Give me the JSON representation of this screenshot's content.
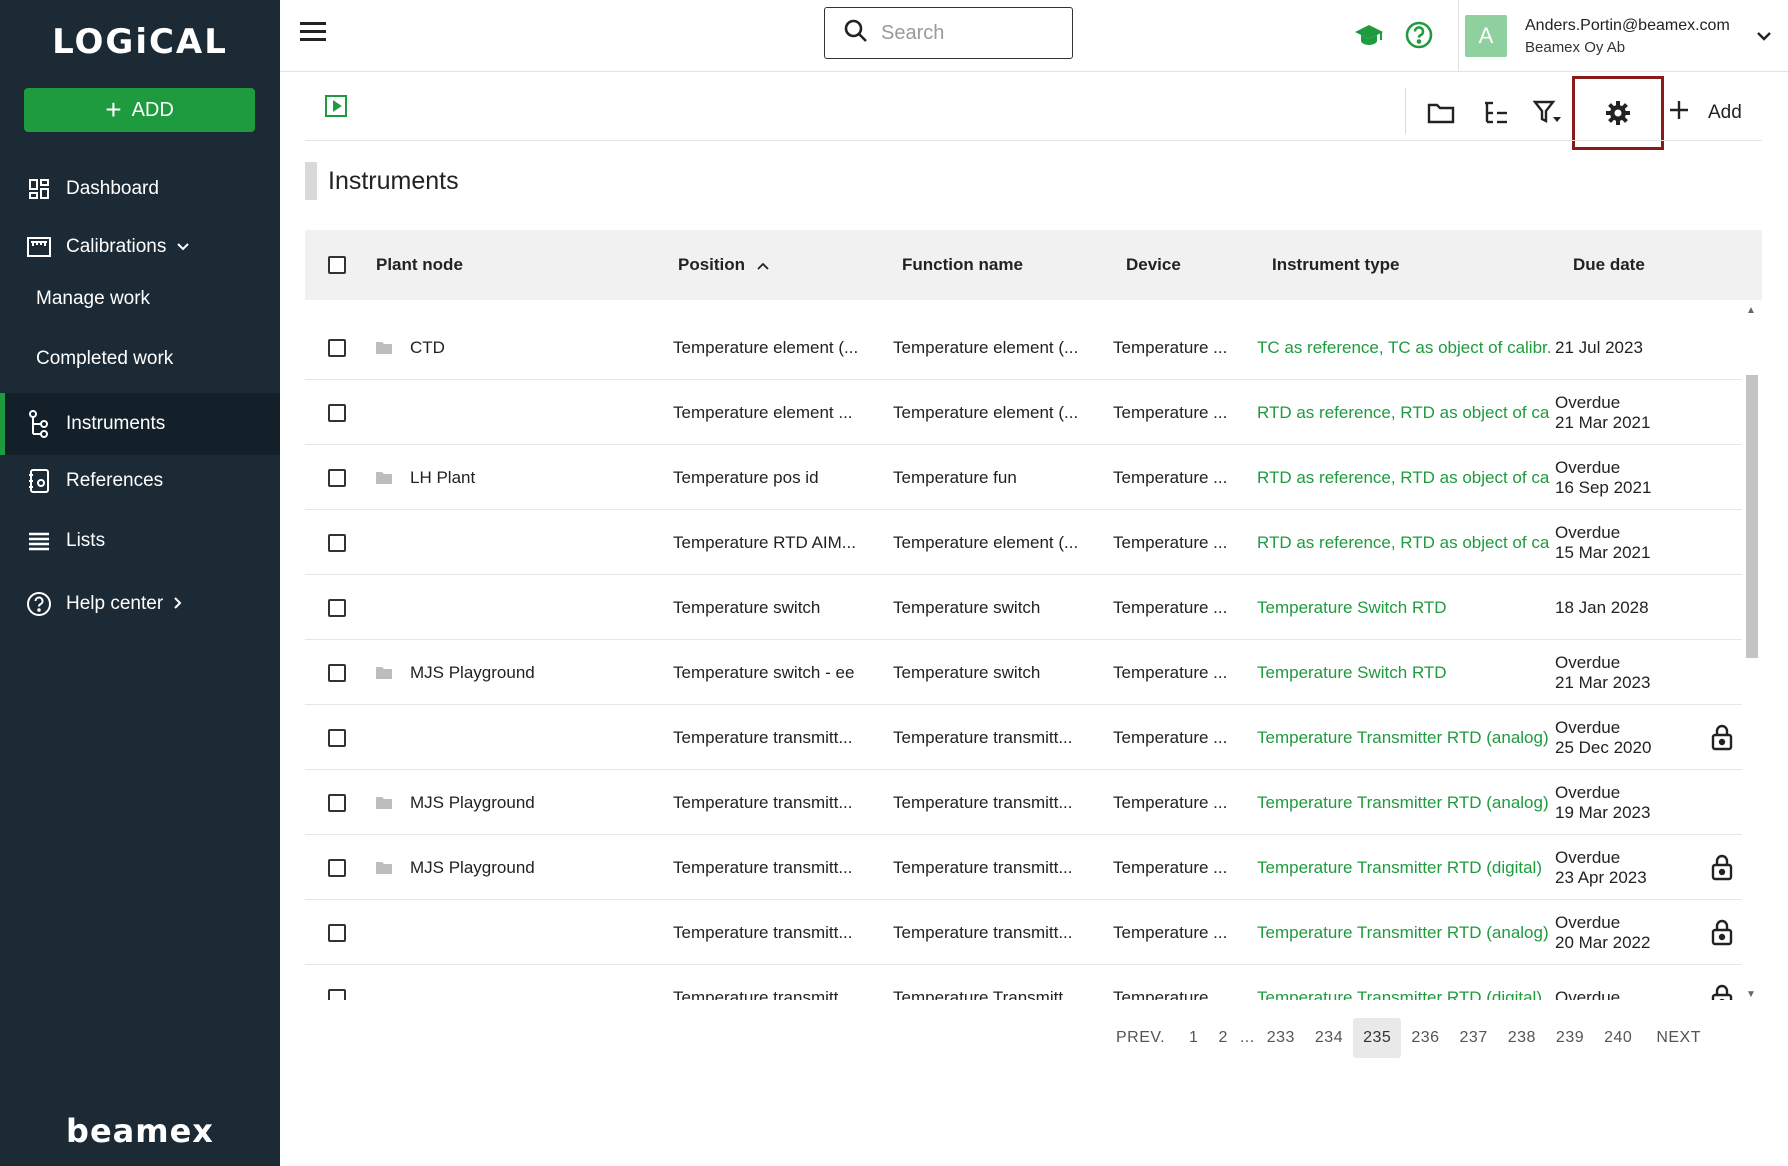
{
  "app": {
    "logo_text": "LOGiCAL",
    "brand_text": "beamex"
  },
  "sidebar": {
    "add_label": "ADD",
    "items": [
      {
        "label": "Dashboard"
      },
      {
        "label": "Calibrations"
      },
      {
        "label": "Manage work"
      },
      {
        "label": "Completed work"
      },
      {
        "label": "Instruments"
      },
      {
        "label": "References"
      },
      {
        "label": "Lists"
      },
      {
        "label": "Help center"
      }
    ],
    "active": "Instruments"
  },
  "topbar": {
    "search_placeholder": "Search",
    "user_initial": "A",
    "user_email": "Anders.Portin@beamex.com",
    "user_org": "Beamex Oy Ab"
  },
  "toolbar": {
    "add_label": "Add"
  },
  "page": {
    "title": "Instruments"
  },
  "table": {
    "columns": [
      "Plant node",
      "Position",
      "Function name",
      "Device",
      "Instrument type",
      "Due date"
    ],
    "sorted_column": "Position",
    "sort_direction": "ascending",
    "rows": [
      {
        "plant_node": "CTD",
        "position": "Temperature element (...",
        "function_name": "Temperature element (...",
        "device": "Temperature ...",
        "instrument_type": "TC as reference, TC as object of calibr.",
        "due_status": "",
        "due_date": "21 Jul 2023",
        "locked": false
      },
      {
        "plant_node": "",
        "position": "Temperature element ...",
        "function_name": "Temperature element (...",
        "device": "Temperature ...",
        "instrument_type": "RTD as reference, RTD as object of ca",
        "due_status": "Overdue",
        "due_date": "21 Mar 2021",
        "locked": false
      },
      {
        "plant_node": "LH Plant",
        "position": "Temperature pos id",
        "function_name": "Temperature fun",
        "device": "Temperature ...",
        "instrument_type": "RTD as reference, RTD as object of ca",
        "due_status": "Overdue",
        "due_date": "16 Sep 2021",
        "locked": false
      },
      {
        "plant_node": "",
        "position": "Temperature RTD AIM...",
        "function_name": "Temperature element (...",
        "device": "Temperature ...",
        "instrument_type": "RTD as reference, RTD as object of ca",
        "due_status": "Overdue",
        "due_date": "15 Mar 2021",
        "locked": false
      },
      {
        "plant_node": "",
        "position": "Temperature switch",
        "function_name": "Temperature switch",
        "device": "Temperature ...",
        "instrument_type": "Temperature Switch RTD",
        "due_status": "",
        "due_date": "18 Jan 2028",
        "locked": false
      },
      {
        "plant_node": "MJS Playground",
        "position": "Temperature switch - ee",
        "function_name": "Temperature switch",
        "device": "Temperature ...",
        "instrument_type": "Temperature Switch RTD",
        "due_status": "Overdue",
        "due_date": "21 Mar 2023",
        "locked": false
      },
      {
        "plant_node": "",
        "position": "Temperature transmitt...",
        "function_name": "Temperature transmitt...",
        "device": "Temperature ...",
        "instrument_type": "Temperature Transmitter RTD (analog)",
        "due_status": "Overdue",
        "due_date": "25 Dec 2020",
        "locked": true
      },
      {
        "plant_node": "MJS Playground",
        "position": "Temperature transmitt...",
        "function_name": "Temperature transmitt...",
        "device": "Temperature ...",
        "instrument_type": "Temperature Transmitter RTD (analog)",
        "due_status": "Overdue",
        "due_date": "19 Mar 2023",
        "locked": false
      },
      {
        "plant_node": "MJS Playground",
        "position": "Temperature transmitt...",
        "function_name": "Temperature transmitt...",
        "device": "Temperature ...",
        "instrument_type": "Temperature Transmitter RTD (digital)",
        "due_status": "Overdue",
        "due_date": "23 Apr 2023",
        "locked": true
      },
      {
        "plant_node": "",
        "position": "Temperature transmitt...",
        "function_name": "Temperature transmitt...",
        "device": "Temperature ...",
        "instrument_type": "Temperature Transmitter RTD (analog)",
        "due_status": "Overdue",
        "due_date": "20 Mar 2022",
        "locked": true
      },
      {
        "plant_node": "",
        "position": "Temperature transmitt...",
        "function_name": "Temperature Transmitt...",
        "device": "Temperature ...",
        "instrument_type": "Temperature Transmitter RTD (digital)",
        "due_status": "Overdue",
        "due_date": "",
        "locked": true
      }
    ]
  },
  "pagination": {
    "prev_label": "PREV.",
    "next_label": "NEXT",
    "pages": [
      "1",
      "2",
      "...",
      "233",
      "234",
      "235",
      "236",
      "237",
      "238",
      "239",
      "240"
    ],
    "current": "235"
  },
  "colors": {
    "accent": "#1e9b3e",
    "sidebar_bg": "#1b2a35",
    "highlight": "#8b1a1a"
  }
}
